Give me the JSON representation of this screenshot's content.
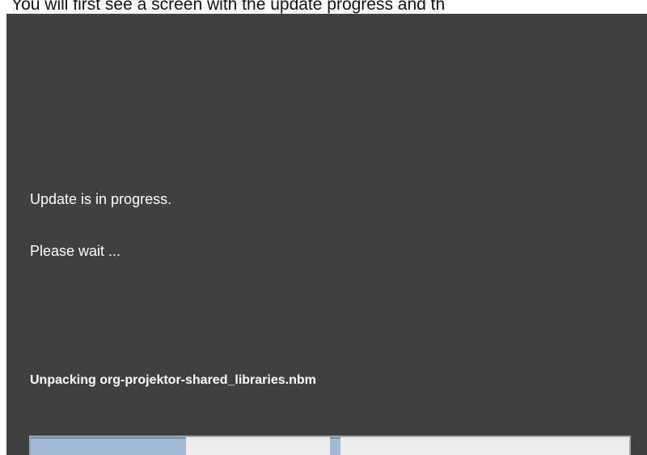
{
  "caption": "You will first see a screen with the update progress and th",
  "dialog": {
    "message_line1": "Update is in progress.",
    "message_line2": "Please wait ...",
    "status_text": "Unpacking  org-projektor-shared_libraries.nbm",
    "progress_fraction": 0.26
  },
  "colors": {
    "panel_background": "#404040",
    "progress_fill": "#a3b9d3",
    "progress_track": "#ececec"
  }
}
